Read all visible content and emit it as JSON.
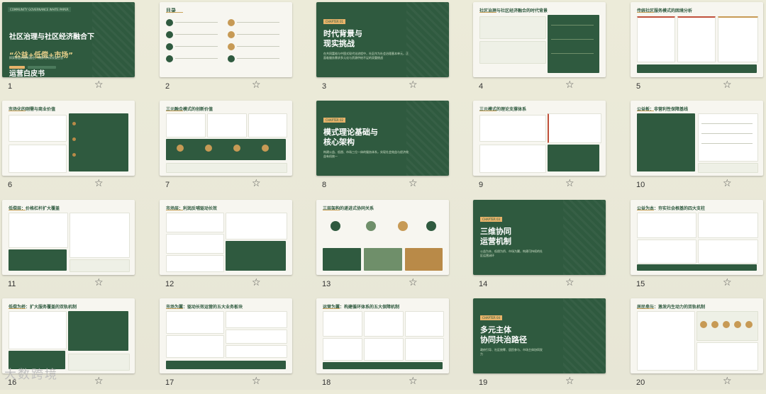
{
  "watermark": "大数跨境",
  "slides": [
    {
      "num": "1",
      "tag": "COMMUNITY GOVERNANCE WHITE PAPER",
      "title": "社区治理与社区经济融合下",
      "title_gold": "“公益+低偿+市场”",
      "title3": "运营白皮书",
      "subtitle": "探索基层治理新路径，构建可持续发展生态"
    },
    {
      "num": "2",
      "title": "目录"
    },
    {
      "num": "3",
      "label": "CHAPTER 01",
      "title": "时代背景与\n现实挑战",
      "subtitle": "在共同富裕与中国式现代化进程中，社区作为社会治理基本单元，正面临服务需求多元化与资源供给不足的双重挑战"
    },
    {
      "num": "4",
      "title": "社区治理与社区经济融合的时代背景"
    },
    {
      "num": "5",
      "title": "传统社区服务模式的困境分析"
    },
    {
      "num": "6",
      "title": "市场化的刚需与商业价值"
    },
    {
      "num": "7",
      "title": "三元融合模式的创新价值"
    },
    {
      "num": "8",
      "label": "CHAPTER 02",
      "title": "模式理论基础与\n核心架构",
      "subtitle": "构建公益、低偿、市场三位一体的服务体系，实现社会效益与经济效益有机统一"
    },
    {
      "num": "9",
      "title": "三元模式的理论支撑体系"
    },
    {
      "num": "10",
      "title": "公益板：非营利性保障基线"
    },
    {
      "num": "11",
      "title": "低偿层：价格杠杆扩大覆盖"
    },
    {
      "num": "12",
      "title": "市场层：利润反哺驱动长效"
    },
    {
      "num": "13",
      "title": "三层架构的递进式协同关系"
    },
    {
      "num": "14",
      "label": "CHAPTER 03",
      "title": "三维协同\n运营机制",
      "subtitle": "公益为本、低偿为桥、市场为翼，构建可持续的社区运营闭环"
    },
    {
      "num": "15",
      "title": "公益为本：夯实社会根基的四大支柱"
    },
    {
      "num": "16",
      "title": "低偿为桥：扩大服务覆盖的双轨机制"
    },
    {
      "num": "17",
      "title": "市场为翼：驱动长效运营的五大业务板块"
    },
    {
      "num": "18",
      "title": "运营为翼：构建循环体系的五大保障机制"
    },
    {
      "num": "19",
      "label": "CHAPTER 04",
      "title": "多元主体\n协同共治路径",
      "subtitle": "政府引导、社区统筹、居民参与、市场主体协同发力"
    },
    {
      "num": "20",
      "title": "居民参与：激发内生动力的双轨机制"
    }
  ]
}
